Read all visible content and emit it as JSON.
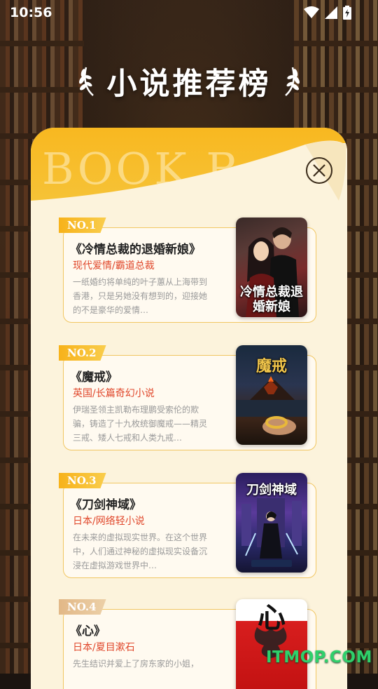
{
  "status": {
    "time": "10:56"
  },
  "title": "小说推荐榜",
  "card": {
    "bg_text": "BOOK R"
  },
  "books": [
    {
      "rank": "NO.1",
      "title": "《冷情总裁的退婚新娘》",
      "genre": "现代爱情/霸道总裁",
      "desc": "一纸婚约将单纯的叶子蕙从上海带到香港，只是另她没有想到的，迎接她的不是豪华的爱情…",
      "cover_text": "冷情总裁退婚新娘"
    },
    {
      "rank": "NO.2",
      "title": "《魔戒》",
      "genre": "英国/长篇奇幻小说",
      "desc": "伊瑞圣领主凯勒布理鹏受索伦的欺骗，铸造了十九枚统御魔戒——精灵三戒、矮人七戒和人类九戒…",
      "cover_text": "魔戒"
    },
    {
      "rank": "NO.3",
      "title": "《刀剑神域》",
      "genre": "日本/网络轻小说",
      "desc": "在未来的虚拟现实世界。在这个世界中，人们通过神秘的虚拟现实设备沉浸在虚拟游戏世界中…",
      "cover_text": "刀剑神域"
    },
    {
      "rank": "NO.4",
      "title": "《心》",
      "genre": "日本/夏目漱石",
      "desc": "先生结识并爱上了房东家的小姐，",
      "cover_text": "心"
    }
  ],
  "watermark": "ITMOP.COM",
  "icons": {
    "close": "close-icon",
    "wifi": "wifi-icon",
    "signal": "signal-icon",
    "battery": "battery-icon",
    "laurel": "laurel-icon"
  },
  "colors": {
    "accent": "#f8b820",
    "genre": "#e0472b",
    "card_bg": "#fcf3dc"
  }
}
